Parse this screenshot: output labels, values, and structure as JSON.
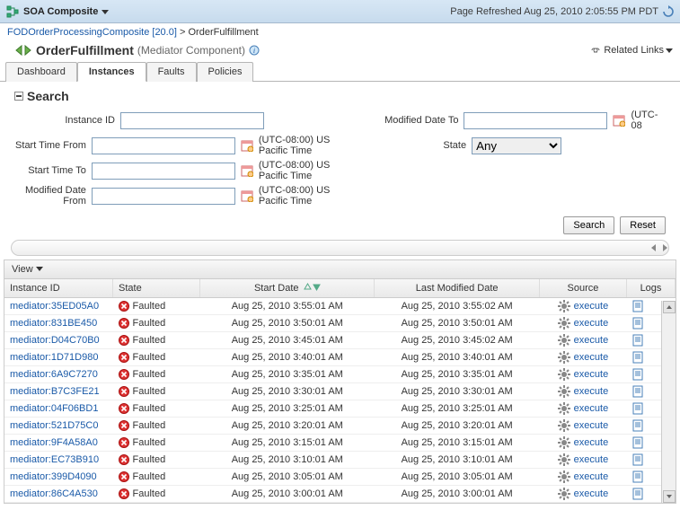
{
  "topbar": {
    "title": "SOA Composite",
    "refreshed": "Page Refreshed Aug 25, 2010 2:05:55 PM PDT"
  },
  "breadcrumb": {
    "parent": "FODOrderProcessingComposite [20.0]",
    "sep": ">",
    "current": "OrderFulfillment"
  },
  "component": {
    "name": "OrderFulfillment",
    "type": "(Mediator Component)",
    "related": "Related Links"
  },
  "tabs": {
    "dashboard": "Dashboard",
    "instances": "Instances",
    "faults": "Faults",
    "policies": "Policies"
  },
  "search": {
    "title": "Search",
    "labels": {
      "instance_id": "Instance ID",
      "start_from": "Start Time From",
      "start_to": "Start Time To",
      "modified_from": "Modified Date From",
      "modified_to": "Modified Date To",
      "state": "State"
    },
    "tz": "(UTC-08:00) US Pacific Time",
    "tz_short": "(UTC-08",
    "state_value": "Any",
    "search_btn": "Search",
    "reset_btn": "Reset"
  },
  "view": {
    "label": "View"
  },
  "table": {
    "headers": {
      "instance_id": "Instance ID",
      "state": "State",
      "start_date": "Start Date",
      "last_modified": "Last Modified Date",
      "source": "Source",
      "logs": "Logs"
    },
    "source_label": "execute",
    "rows": [
      {
        "id": "mediator:35ED05A0",
        "state": "Faulted",
        "start": "Aug 25, 2010 3:55:01 AM",
        "modified": "Aug 25, 2010 3:55:02 AM"
      },
      {
        "id": "mediator:831BE450",
        "state": "Faulted",
        "start": "Aug 25, 2010 3:50:01 AM",
        "modified": "Aug 25, 2010 3:50:01 AM"
      },
      {
        "id": "mediator:D04C70B0",
        "state": "Faulted",
        "start": "Aug 25, 2010 3:45:01 AM",
        "modified": "Aug 25, 2010 3:45:02 AM"
      },
      {
        "id": "mediator:1D71D980",
        "state": "Faulted",
        "start": "Aug 25, 2010 3:40:01 AM",
        "modified": "Aug 25, 2010 3:40:01 AM"
      },
      {
        "id": "mediator:6A9C7270",
        "state": "Faulted",
        "start": "Aug 25, 2010 3:35:01 AM",
        "modified": "Aug 25, 2010 3:35:01 AM"
      },
      {
        "id": "mediator:B7C3FE21",
        "state": "Faulted",
        "start": "Aug 25, 2010 3:30:01 AM",
        "modified": "Aug 25, 2010 3:30:01 AM"
      },
      {
        "id": "mediator:04F06BD1",
        "state": "Faulted",
        "start": "Aug 25, 2010 3:25:01 AM",
        "modified": "Aug 25, 2010 3:25:01 AM"
      },
      {
        "id": "mediator:521D75C0",
        "state": "Faulted",
        "start": "Aug 25, 2010 3:20:01 AM",
        "modified": "Aug 25, 2010 3:20:01 AM"
      },
      {
        "id": "mediator:9F4A58A0",
        "state": "Faulted",
        "start": "Aug 25, 2010 3:15:01 AM",
        "modified": "Aug 25, 2010 3:15:01 AM"
      },
      {
        "id": "mediator:EC73B910",
        "state": "Faulted",
        "start": "Aug 25, 2010 3:10:01 AM",
        "modified": "Aug 25, 2010 3:10:01 AM"
      },
      {
        "id": "mediator:399D4090",
        "state": "Faulted",
        "start": "Aug 25, 2010 3:05:01 AM",
        "modified": "Aug 25, 2010 3:05:01 AM"
      },
      {
        "id": "mediator:86C4A530",
        "state": "Faulted",
        "start": "Aug 25, 2010 3:00:01 AM",
        "modified": "Aug 25, 2010 3:00:01 AM"
      }
    ]
  }
}
